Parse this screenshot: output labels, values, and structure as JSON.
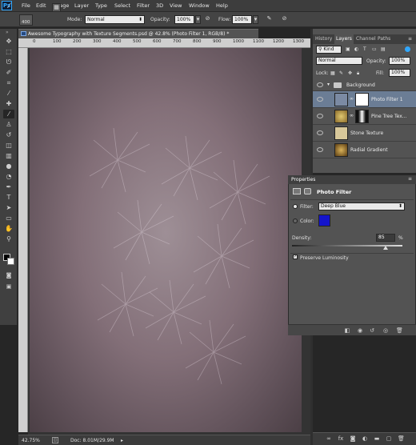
{
  "menubar": {
    "app_logo": "Ps",
    "items": [
      "File",
      "Edit",
      "Image",
      "Layer",
      "Type",
      "Select",
      "Filter",
      "3D",
      "View",
      "Window",
      "Help"
    ]
  },
  "options": {
    "brush_size": "400",
    "mode_label": "Mode:",
    "mode_value": "Normal",
    "opacity_label": "Opacity:",
    "opacity_value": "100%",
    "flow_label": "Flow:",
    "flow_value": "100%"
  },
  "document": {
    "tab_title": "Awesome Typography with Texture Segments.psd @ 42.8% (Photo Filter 1, RGB/8) *",
    "ruler_ticks": [
      "0",
      "100",
      "200",
      "300",
      "400",
      "500",
      "600",
      "700",
      "800",
      "900",
      "1000",
      "1100",
      "1200",
      "1300"
    ],
    "zoom": "42.75%",
    "doc_size": "Doc: 8.01M/29.9M"
  },
  "layers_panel": {
    "tabs": [
      "History",
      "Layers",
      "Channel",
      "Paths"
    ],
    "active_tab": "Layers",
    "filter_kind": "Kind",
    "blend_mode": "Normal",
    "opacity_label": "Opacity:",
    "opacity_value": "100%",
    "lock_label": "Lock:",
    "fill_label": "Fill:",
    "fill_value": "100%",
    "group_name": "Background",
    "layers": [
      {
        "name": "Photo Filter 1",
        "selected": true
      },
      {
        "name": "Pine Tree Tex...",
        "selected": false
      },
      {
        "name": "Stone Texture",
        "selected": false
      },
      {
        "name": "Radial Gradient",
        "selected": false
      }
    ]
  },
  "properties": {
    "panel_title": "Properties",
    "adjustment_title": "Photo Filter",
    "filter_label": "Filter:",
    "filter_value": "Deep Blue",
    "color_label": "Color:",
    "color_swatch": "#1414cc",
    "density_label": "Density:",
    "density_value": "85",
    "density_unit": "%",
    "density_fraction": 0.85,
    "preserve_label": "Preserve Luminosity",
    "preserve_checked": true
  },
  "colors": {
    "accent": "#31a8ff",
    "selected_row": "#6b7d95"
  }
}
